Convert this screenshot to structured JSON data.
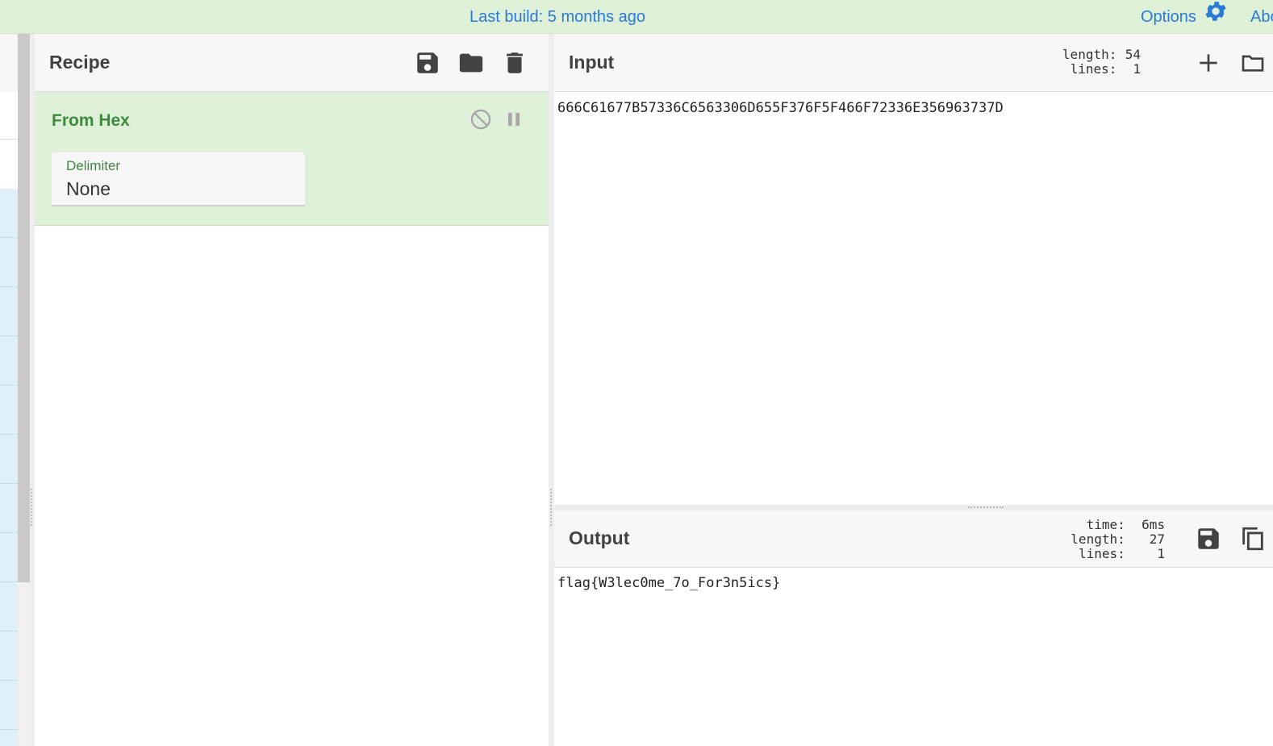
{
  "banner": {
    "text": "Last build: 5 months ago",
    "options_label": "Options",
    "about_label": "About / Support"
  },
  "recipe": {
    "title": "Recipe",
    "icons": [
      "save-icon",
      "folder-icon",
      "trash-icon"
    ],
    "operations": [
      {
        "name": "From Hex",
        "args": [
          {
            "label": "Delimiter",
            "value": "None"
          }
        ]
      }
    ]
  },
  "input": {
    "title": "Input",
    "stats": {
      "length_label": "length:",
      "length_value": "54",
      "lines_label": "lines:",
      "lines_value": "1"
    },
    "text": "666C61677B57336C6563306D655F376F5F466F72336E356963737D"
  },
  "output": {
    "title": "Output",
    "stats": {
      "time_label": "time:",
      "time_value": "6ms",
      "length_label": "length:",
      "length_value": "27",
      "lines_label": "lines:",
      "lines_value": "1"
    },
    "text": "flag{W3lec0me_7o_For3n5ics}"
  },
  "colors": {
    "banner_bg": "#dff0d8",
    "link_blue": "#2a7ad6",
    "operation_green": "#3c8a3c",
    "operation_bg": "#dff0d8"
  }
}
